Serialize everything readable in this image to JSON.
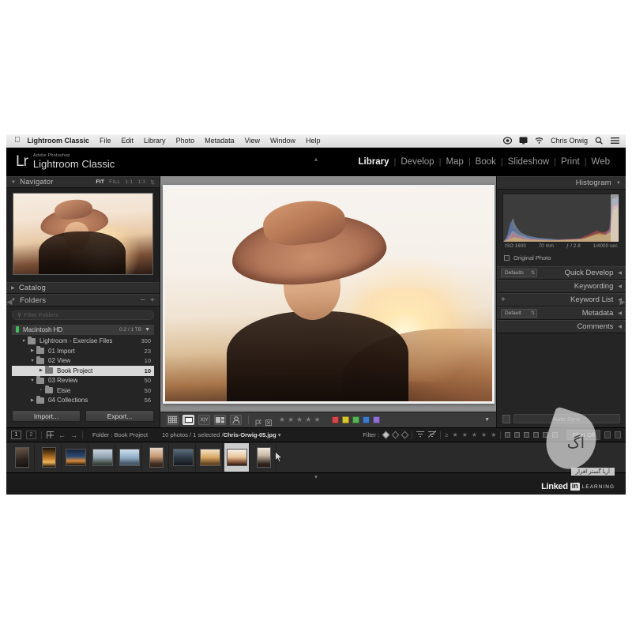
{
  "macbar": {
    "apple": "apple-logo",
    "app_name": "Lightroom Classic",
    "menus": [
      "File",
      "Edit",
      "Library",
      "Photo",
      "Metadata",
      "View",
      "Window",
      "Help"
    ],
    "user": "Chris Orwig",
    "right_icons": [
      "control-center-icon",
      "display-icon",
      "wifi-icon",
      "spotlight-search-icon",
      "notification-center-icon"
    ]
  },
  "identity": {
    "mark": "Lr",
    "superscript": "Adobe Photoshop",
    "name": "Lightroom Classic"
  },
  "modules": {
    "items": [
      "Library",
      "Develop",
      "Map",
      "Book",
      "Slideshow",
      "Print",
      "Web"
    ],
    "active": "Library",
    "separator": "|"
  },
  "left_panel": {
    "navigator": {
      "title": "Navigator",
      "zoom_options": [
        "FIT",
        "FILL",
        "1:1",
        "1:3"
      ],
      "active_zoom": "FIT",
      "stepper": "zoom-stepper-icon"
    },
    "catalog": {
      "title": "Catalog"
    },
    "folders": {
      "title": "Folders",
      "minus": "−",
      "plus": "+",
      "search_placeholder": "Filter Folders",
      "volume": {
        "name": "Macintosh HD",
        "capacity": "0.2 / 1 TB"
      },
      "tree": [
        {
          "name": "Lightroom - Exercise Files",
          "count": "300",
          "indent": 0,
          "expanded": true,
          "selected": false
        },
        {
          "name": "01 Import",
          "count": "23",
          "indent": 1,
          "expanded": false,
          "selected": false
        },
        {
          "name": "02 View",
          "count": "10",
          "indent": 1,
          "expanded": true,
          "selected": false
        },
        {
          "name": "Book Project",
          "count": "10",
          "indent": 2,
          "expanded": false,
          "selected": true
        },
        {
          "name": "03 Review",
          "count": "50",
          "indent": 1,
          "expanded": true,
          "selected": false
        },
        {
          "name": "Elsie",
          "count": "50",
          "indent": 2,
          "expanded": false,
          "selected": false
        },
        {
          "name": "04 Collections",
          "count": "56",
          "indent": 1,
          "expanded": false,
          "selected": false
        }
      ]
    },
    "import_label": "Import...",
    "export_label": "Export..."
  },
  "right_panel": {
    "histogram": {
      "title": "Histogram",
      "iso": "ISO 1600",
      "focal": "70 mm",
      "aperture": "ƒ / 2.8",
      "shutter": "1/4000 sec"
    },
    "original_photo": "Original Photo",
    "sections": [
      {
        "title": "Quick Develop",
        "control": "Defaults",
        "has_select": true,
        "has_plus": false
      },
      {
        "title": "Keywording",
        "control": "",
        "has_select": false,
        "has_plus": false
      },
      {
        "title": "Keyword List",
        "control": "",
        "has_select": false,
        "has_plus": true
      },
      {
        "title": "Metadata",
        "control": "Default",
        "has_select": true,
        "has_plus": false
      },
      {
        "title": "Comments",
        "control": "",
        "has_select": false,
        "has_plus": false
      }
    ],
    "auto_sync": "Auto Sync"
  },
  "toolbar": {
    "view_buttons": [
      "grid-view-icon",
      "loupe-view-icon",
      "compare-view-icon",
      "survey-view-icon",
      "people-view-icon"
    ],
    "active_view": "loupe-view-icon",
    "flag_buttons": [
      "flag-pick-icon",
      "flag-reject-icon"
    ],
    "star_count": 5,
    "star_glyph": "★",
    "color_labels": [
      "#d5484a",
      "#d8c62e",
      "#57b356",
      "#3f79c9",
      "#8f6fd0"
    ],
    "caret": "▼"
  },
  "filmstrip": {
    "page_primary": "1",
    "page_secondary": "2",
    "grid_icon": "grid-icon",
    "back_arrow": "←",
    "forward_arrow": "→",
    "folder_label": "Folder : Book Project",
    "count_text": "10 photos / 1 selected /",
    "filename": "Chris-Orwig-05.jpg",
    "filename_caret": "▾",
    "filter_label": "Filter :",
    "filter_off": "Filter Off",
    "star_glyph": "★",
    "gte_glyph": "≥",
    "thumb_count": 10,
    "selected_index": 8,
    "cursor": "mouse-pointer"
  },
  "watermark": {
    "brand_1": "Linked",
    "brand_box": "in",
    "brand_2": "LEARNING",
    "farsi": "آریا گستر افزار",
    "logo": "agh-droplet-logo"
  },
  "colors": {
    "window_bg": "#1b1b1b",
    "panel_bg": "#252525",
    "canvas_gray": "#8d8d8d",
    "accent_text": "#f0f0f0"
  }
}
